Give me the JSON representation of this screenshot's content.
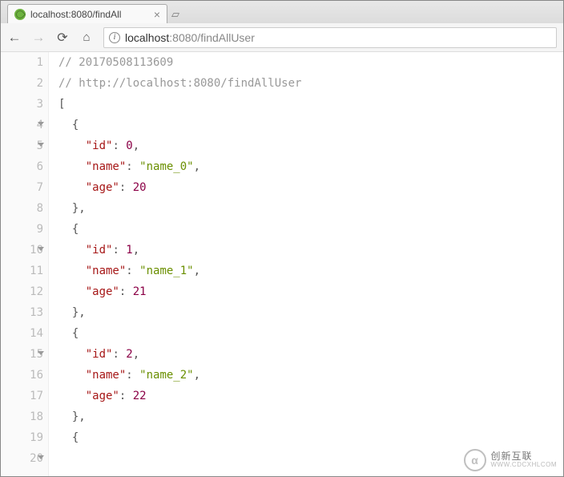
{
  "tab": {
    "title": "localhost:8080/findAll",
    "close": "×"
  },
  "url": {
    "host": "localhost",
    "path": ":8080/findAllUser"
  },
  "code": {
    "comment1": "// 20170508113609",
    "comment2": "// http://localhost:8080/findAllUser",
    "items": [
      {
        "id": 0,
        "name": "name_0",
        "age": 20
      },
      {
        "id": 1,
        "name": "name_1",
        "age": 21
      },
      {
        "id": 2,
        "name": "name_2",
        "age": 22
      }
    ],
    "keys": {
      "id": "\"id\"",
      "name": "\"name\"",
      "age": "\"age\""
    },
    "punct": {
      "open_arr": "[",
      "open_obj": "{",
      "close_obj_c": "},",
      "colon": ": ",
      "comma": ","
    }
  },
  "line_numbers": [
    "1",
    "2",
    "3",
    "4",
    "5",
    "6",
    "7",
    "8",
    "9",
    "10",
    "11",
    "12",
    "13",
    "14",
    "15",
    "16",
    "17",
    "18",
    "19",
    "20"
  ],
  "fold_lines": [
    4,
    5,
    10,
    15,
    20
  ],
  "watermark": {
    "logo": "α",
    "cn": "创新互联",
    "py": "WWW.CDCXHLCOM"
  }
}
